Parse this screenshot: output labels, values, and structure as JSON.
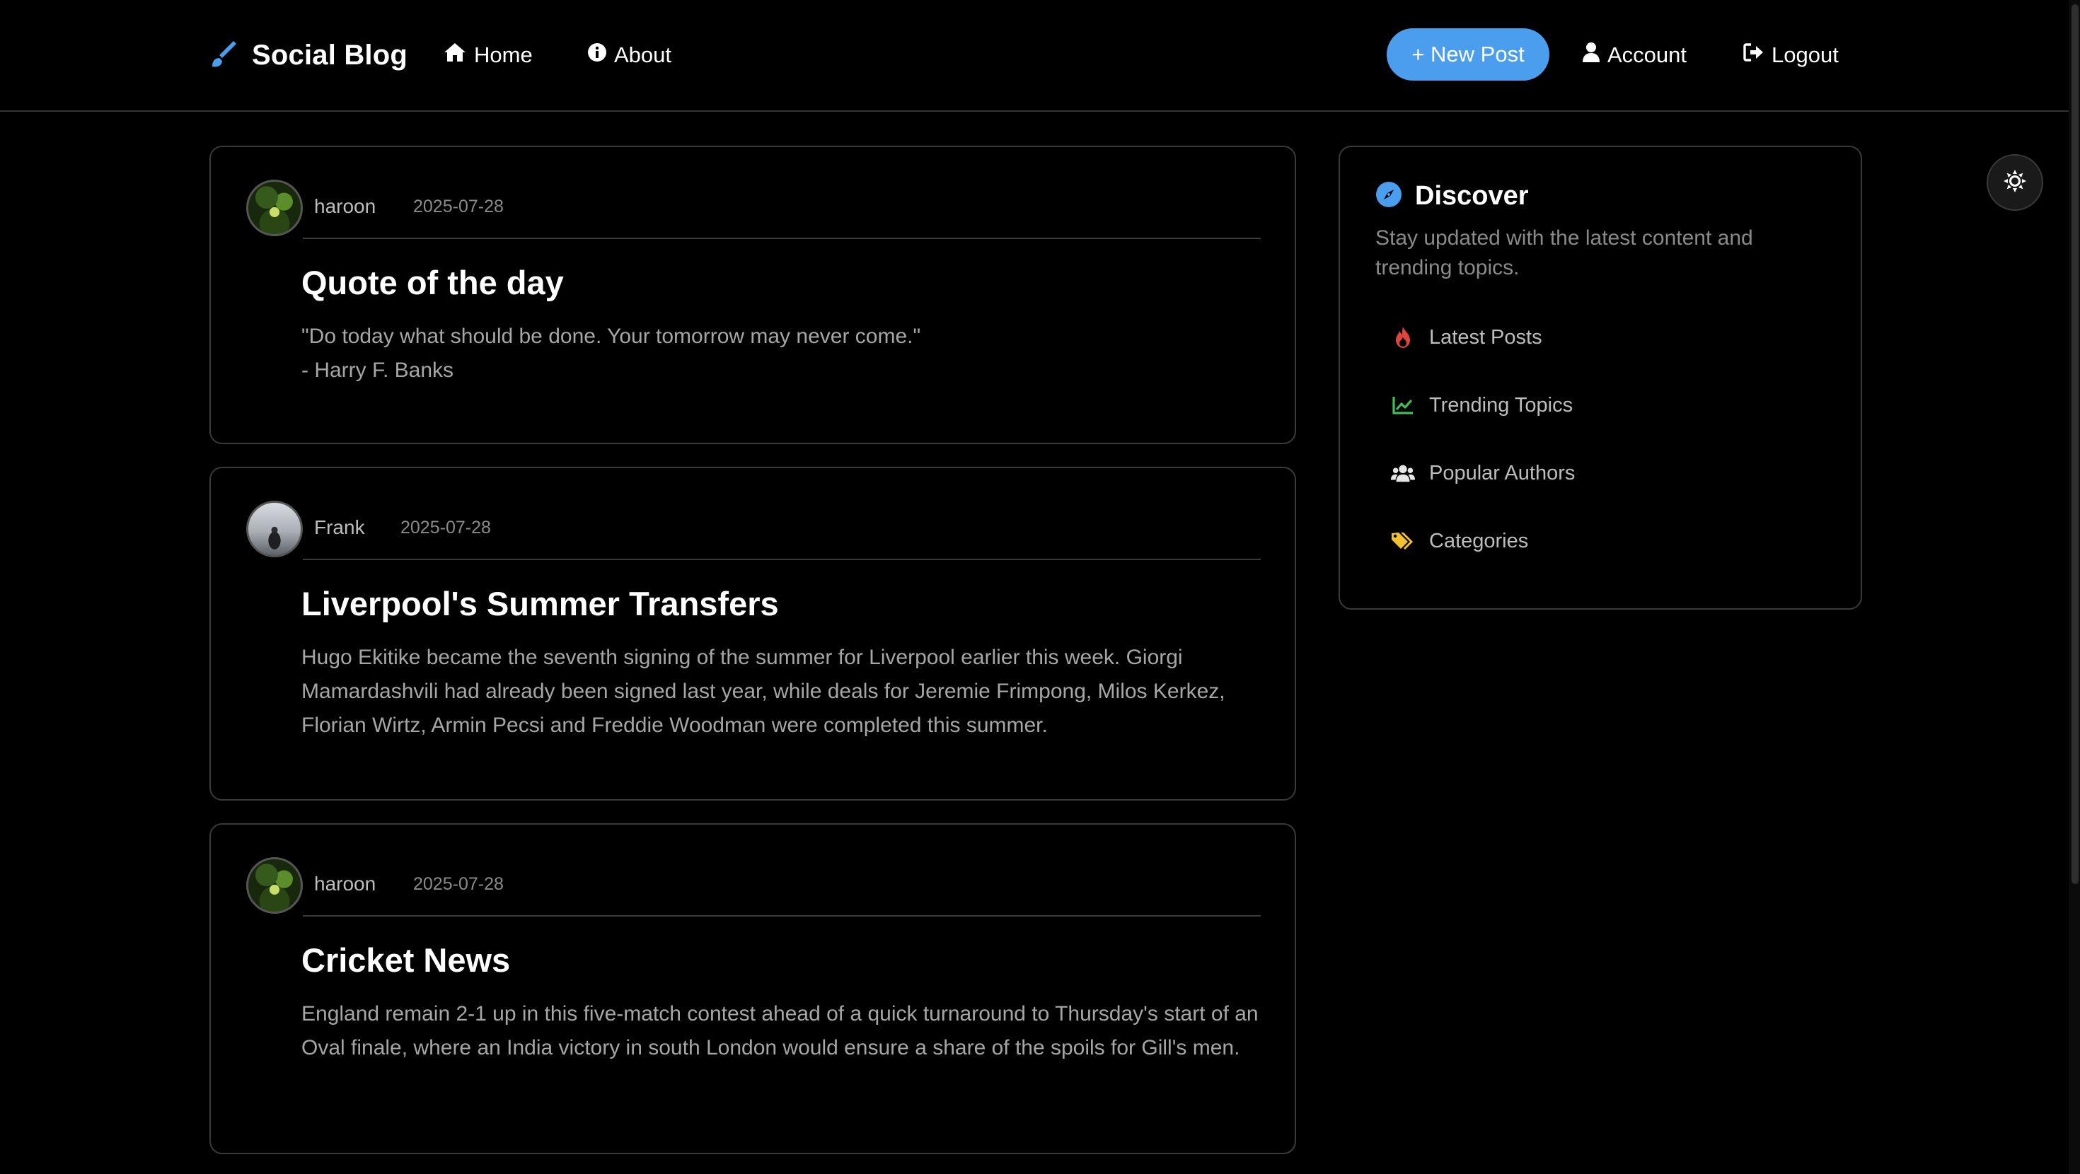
{
  "navbar": {
    "brand": "Social Blog",
    "home": "Home",
    "about": "About",
    "new_post": "+ New Post",
    "account": "Account",
    "logout": "Logout"
  },
  "posts": [
    {
      "author": "haroon",
      "date": "2025-07-28",
      "title": "Quote of the day",
      "body_line1": "\"Do today what should be done. Your tomorrow may never come.\"",
      "body_line2": "- Harry F. Banks"
    },
    {
      "author": "Frank",
      "date": "2025-07-28",
      "title": "Liverpool's Summer Transfers",
      "body": "Hugo Ekitike became the seventh signing of the summer for Liverpool earlier this week. Giorgi Mamardashvili had already been signed last year, while deals for Jeremie Frimpong, Milos Kerkez, Florian Wirtz, Armin Pecsi and Freddie Woodman were completed this summer."
    },
    {
      "author": "haroon",
      "date": "2025-07-28",
      "title": "Cricket News",
      "body": "England remain 2-1 up in this five-match contest ahead of a quick turnaround to Thursday's start of an Oval finale, where an India victory in south London would ensure a share of the spoils for Gill's men."
    }
  ],
  "sidebar": {
    "title": "Discover",
    "description": "Stay updated with the latest content and trending topics.",
    "items": [
      {
        "label": "Latest Posts",
        "icon": "fire-icon",
        "color": "#e0443e"
      },
      {
        "label": "Trending Topics",
        "icon": "chart-line-icon",
        "color": "#3fbf55"
      },
      {
        "label": "Popular Authors",
        "icon": "users-icon",
        "color": "#e6e6e6"
      },
      {
        "label": "Categories",
        "icon": "tags-icon",
        "color": "#f2c230"
      }
    ]
  },
  "colors": {
    "accent": "#4a9eed",
    "background": "#000000",
    "border": "#3a3a3a",
    "muted_text": "#a6a6a6"
  }
}
